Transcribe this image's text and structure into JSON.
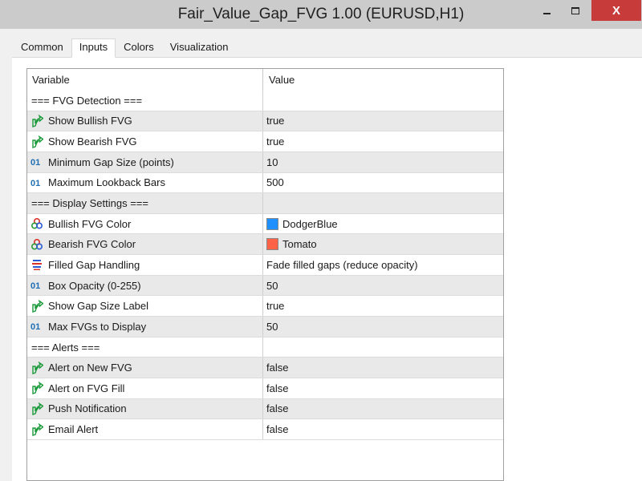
{
  "window": {
    "title": "Fair_Value_Gap_FVG 1.00 (EURUSD,H1)",
    "close_glyph": "X"
  },
  "tabs": [
    {
      "label": "Common",
      "active": false
    },
    {
      "label": "Inputs",
      "active": true
    },
    {
      "label": "Colors",
      "active": false
    },
    {
      "label": "Visualization",
      "active": false
    }
  ],
  "grid": {
    "headers": {
      "variable": "Variable",
      "value": "Value"
    },
    "rows": [
      {
        "type": "section",
        "label": "=== FVG Detection ===",
        "value": ""
      },
      {
        "type": "bool",
        "icon": "bool-arrow-icon",
        "label": "Show Bullish FVG",
        "value": "true"
      },
      {
        "type": "bool",
        "icon": "bool-arrow-icon",
        "label": "Show Bearish FVG",
        "value": "true"
      },
      {
        "type": "int",
        "icon": "int-icon",
        "label": "Minimum Gap Size (points)",
        "value": "10"
      },
      {
        "type": "int",
        "icon": "int-icon",
        "label": "Maximum Lookback Bars",
        "value": "500"
      },
      {
        "type": "section",
        "label": "=== Display Settings ===",
        "value": ""
      },
      {
        "type": "color",
        "icon": "color-icon",
        "label": "Bullish FVG Color",
        "value": "DodgerBlue",
        "swatch": "#1e90ff"
      },
      {
        "type": "color",
        "icon": "color-icon",
        "label": "Bearish FVG Color",
        "value": "Tomato",
        "swatch": "#ff6347"
      },
      {
        "type": "enum",
        "icon": "enum-icon",
        "label": "Filled Gap Handling",
        "value": "Fade filled gaps (reduce opacity)"
      },
      {
        "type": "int",
        "icon": "int-icon",
        "label": "Box Opacity (0-255)",
        "value": "50"
      },
      {
        "type": "bool",
        "icon": "bool-arrow-icon",
        "label": "Show Gap Size Label",
        "value": "true"
      },
      {
        "type": "int",
        "icon": "int-icon",
        "label": "Max FVGs to Display",
        "value": "50"
      },
      {
        "type": "section",
        "label": "=== Alerts ===",
        "value": ""
      },
      {
        "type": "bool",
        "icon": "bool-arrow-icon",
        "label": "Alert on New FVG",
        "value": "false"
      },
      {
        "type": "bool",
        "icon": "bool-arrow-icon",
        "label": "Alert on FVG Fill",
        "value": "false"
      },
      {
        "type": "bool",
        "icon": "bool-arrow-icon",
        "label": "Push Notification",
        "value": "false"
      },
      {
        "type": "bool",
        "icon": "bool-arrow-icon",
        "label": "Email Alert",
        "value": "false"
      }
    ]
  },
  "colors": {
    "titlebar": "#cbcbcb",
    "close_button": "#c73b3b",
    "alt_row": "#e9e9e9",
    "bool_icon": "#1a9a3a",
    "int_icon": "#1f6fb5"
  }
}
